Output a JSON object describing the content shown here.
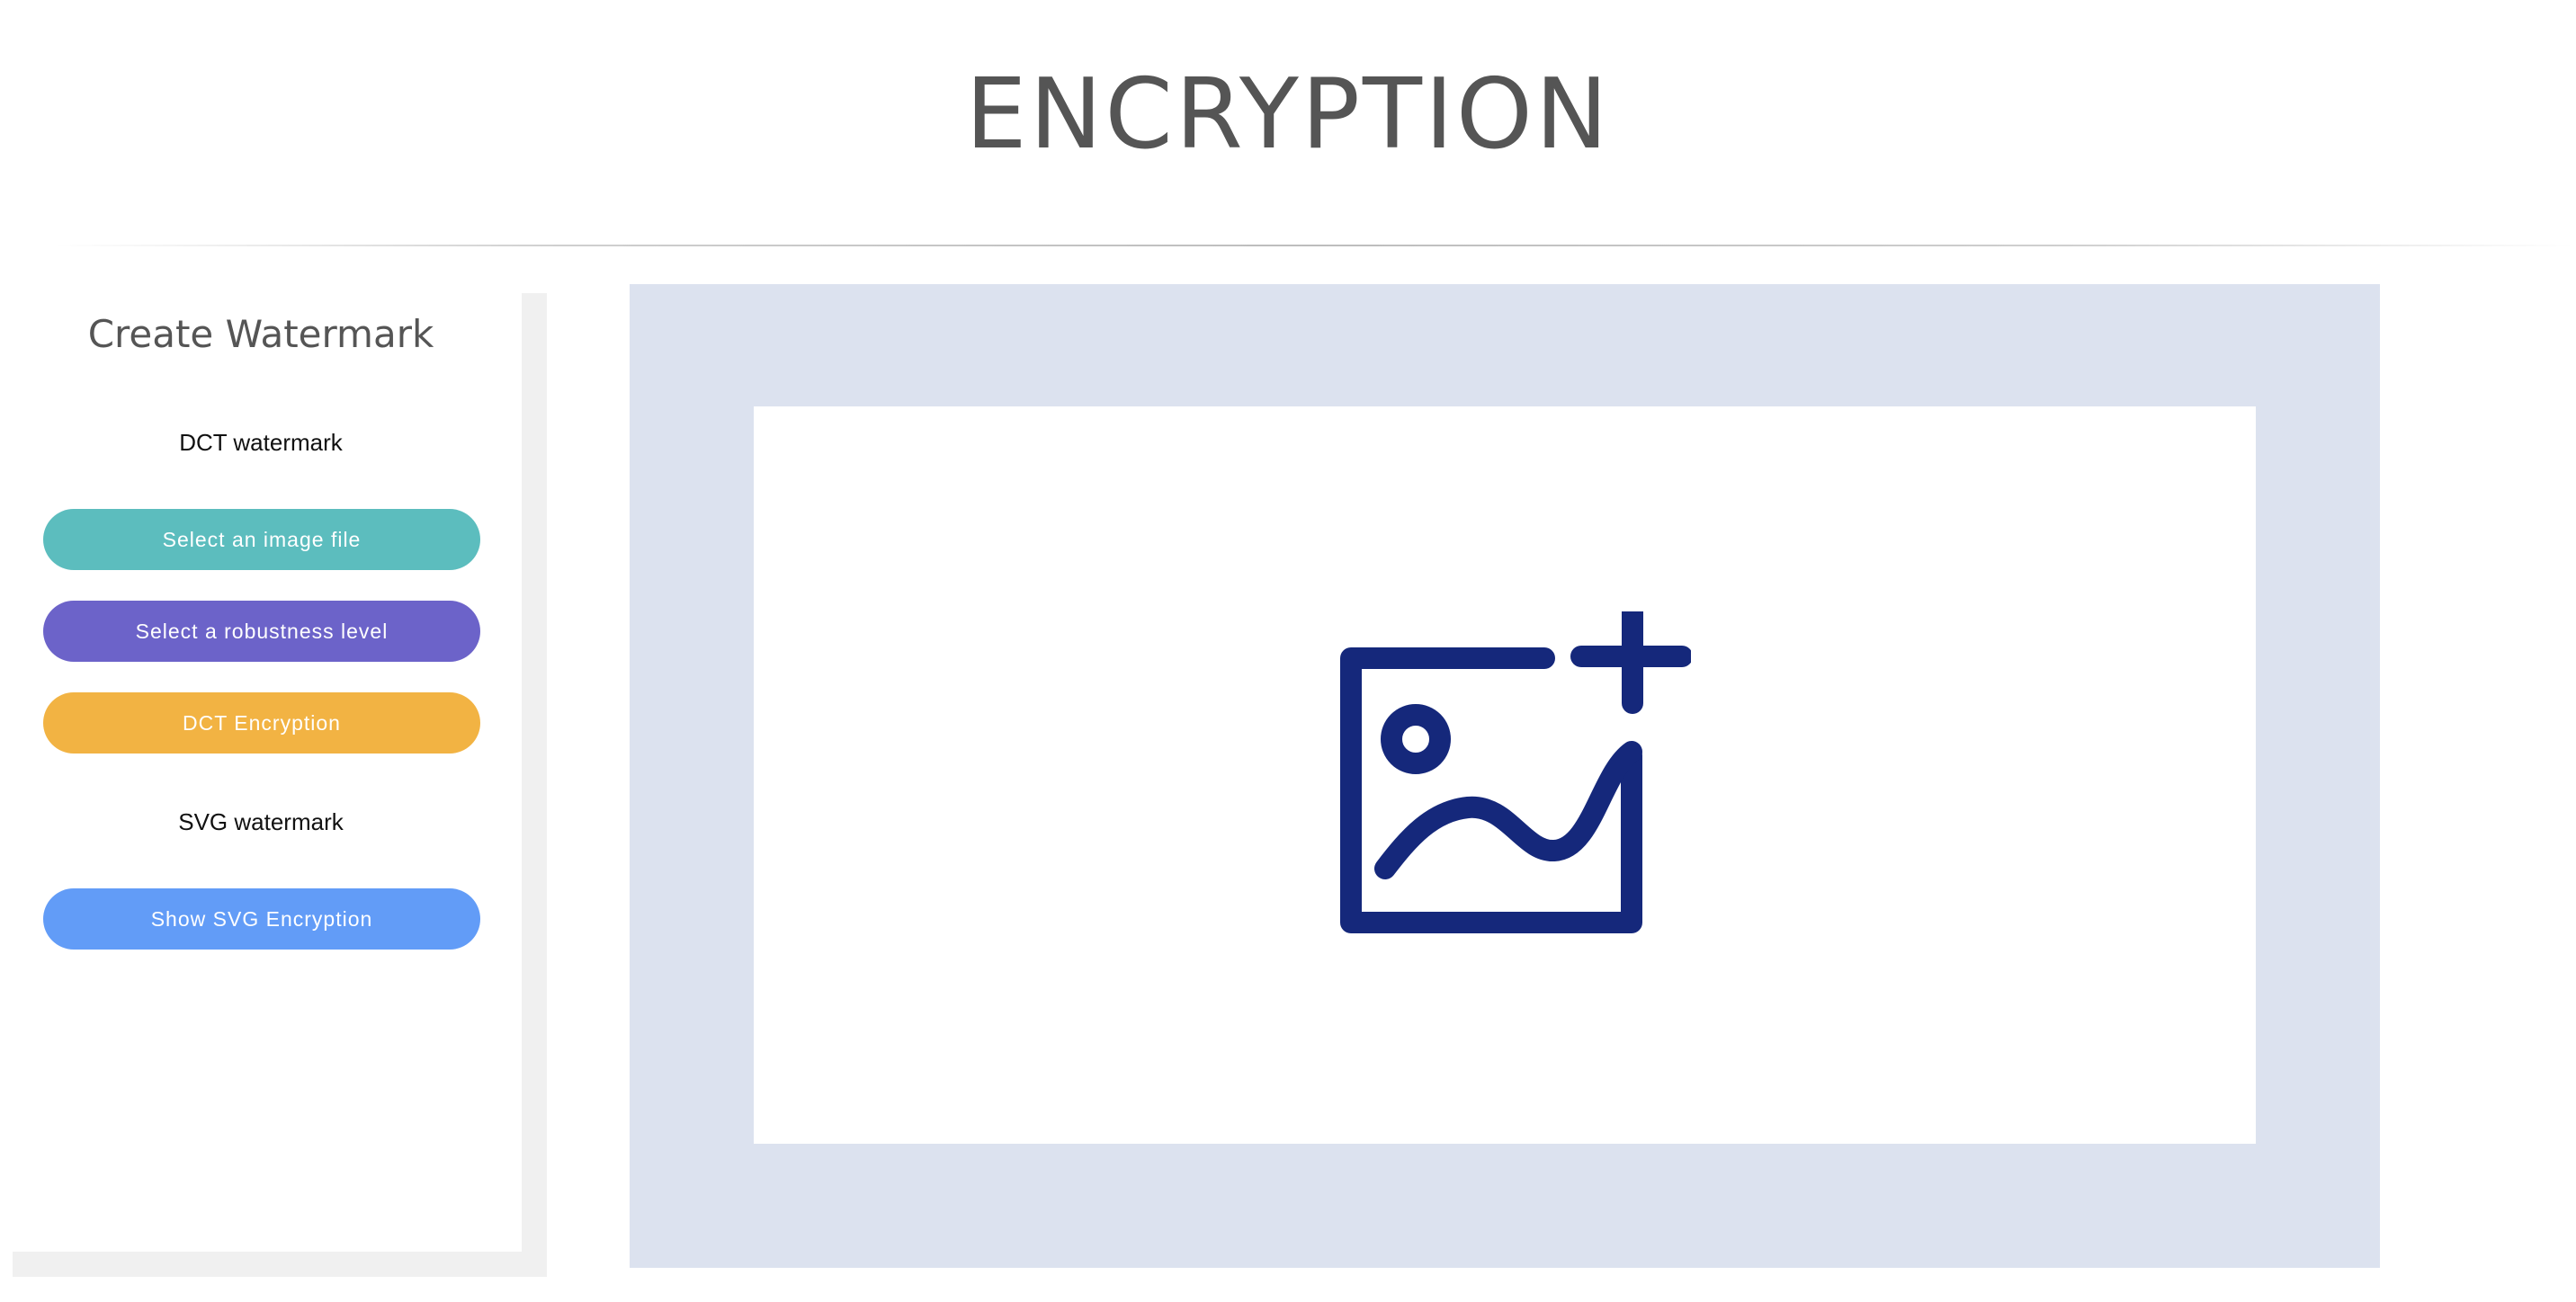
{
  "header": {
    "title": "ENCRYPTION"
  },
  "sidebar": {
    "title": "Create Watermark",
    "dct_section": {
      "label": "DCT watermark",
      "buttons": {
        "select_image": "Select an image file",
        "select_robustness": "Select a robustness level",
        "dct_encryption": "DCT Encryption"
      }
    },
    "svg_section": {
      "label": "SVG watermark",
      "buttons": {
        "show_svg": "Show SVG Encryption"
      }
    }
  },
  "main": {
    "upload_icon": "add-image-icon"
  },
  "colors": {
    "title_text": "#555555",
    "btn_select_image": "#5cbdbe",
    "btn_select_robustness": "#6c63c9",
    "btn_dct_encryption": "#f2b343",
    "btn_show_svg": "#629cf7",
    "stage_background": "#dce2ef",
    "icon_color": "#15287b"
  }
}
